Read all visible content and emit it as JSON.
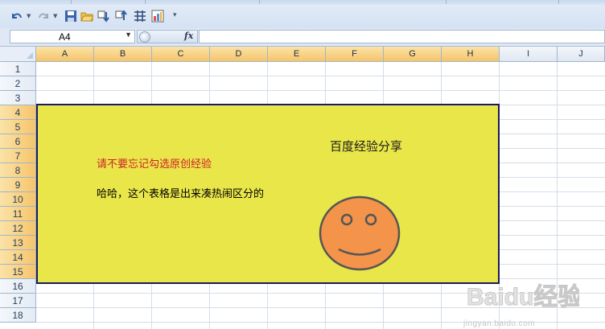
{
  "qat": {
    "buttons": [
      {
        "name": "undo-icon"
      },
      {
        "name": "redo-icon"
      },
      {
        "name": "save-icon"
      },
      {
        "name": "open-icon"
      },
      {
        "name": "sort-ascending-icon"
      },
      {
        "name": "sort-descending-icon"
      },
      {
        "name": "table-icon"
      },
      {
        "name": "chart-icon"
      },
      {
        "name": "customize-icon"
      }
    ]
  },
  "formula_bar": {
    "name_box": "A4",
    "fx_label": "fx",
    "formula": ""
  },
  "columns": [
    "A",
    "B",
    "C",
    "D",
    "E",
    "F",
    "G",
    "H",
    "I",
    "J"
  ],
  "rows": [
    "1",
    "2",
    "3",
    "4",
    "5",
    "6",
    "7",
    "8",
    "9",
    "10",
    "11",
    "12",
    "13",
    "14",
    "15",
    "16",
    "17",
    "18"
  ],
  "sheet": {
    "title": "百度经验分享",
    "reminder": "请不要忘记勾选原创经验",
    "note": "哈哈，这个表格是出来凑热闹区分的"
  },
  "colors": {
    "box_fill": "#e9e649",
    "box_border": "#1a1a5c",
    "smiley_fill": "#f4934a",
    "smiley_stroke": "#555555",
    "reminder_text": "#d0202a",
    "selected_cell": "#ffff00",
    "header_highlight": "#f6c46a"
  },
  "watermark": {
    "main": "Baidu经验",
    "sub": "jingyan.baidu.com"
  }
}
